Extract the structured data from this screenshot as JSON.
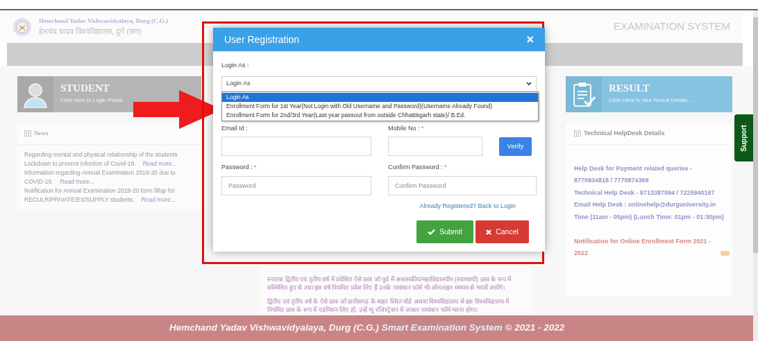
{
  "header": {
    "university_en": "Hemchand Yadav Vishwavidyalaya, Durg (C.G.)",
    "university_hi": "हेमचंद यादव विश्वविद्यालय, दुर्ग (छग)",
    "system_title": "EXAMINATION SYSTEM"
  },
  "cards": [
    {
      "kind": "student",
      "title": "STUDENT",
      "subtitle": "Click here to Login Portal"
    },
    {
      "kind": "result",
      "title": "RESULT",
      "subtitle": "Click Here to See Result Details..."
    }
  ],
  "news": {
    "title": "News",
    "items": [
      {
        "lines": [
          "Regarding mental and physical relationship of the students",
          "Lockdown to prevent infection of Covid-19."
        ],
        "link": "Read more..."
      },
      {
        "lines": [
          "Information regarding Annual Examination 2019-20 due to",
          "COVID-19."
        ],
        "link": "Read more..."
      },
      {
        "lines": [
          "Notification for Annual Examination 2019-20 form fillup for",
          "REGULR/PRIVATE/EX/SUPPLY students."
        ],
        "link": "Read more..."
      }
    ]
  },
  "notice": {
    "paragraphs": [
      "स्नातक द्वितीय एवं तृतीय वर्ष में प्रवेशित ऐसे छात्र जो पूर्व में अशासकीय/महाविद्यालयीन (स्वाध्यायी) छात्र के रूप में सम्मिलित हुए थे तथा इस वर्ष नियमित प्रवेश लिए हैं उनके नामांकन फॉर्म भी ऑनलाइन माध्यम से भरावें जायेंगे।",
      "द्वितीय एवं तृतीय वर्ष के ऐसे छात्र जो छत्तीसगढ़ के बाहर स्थित बोर्ड अथवा विश्वविद्यालय से इस विश्वविद्यालय में नियमित छात्र के रूप में एडमिशन लिए हो, उन्हें न्यू रजिस्ट्रेशन में जाकर नामांकन फॉर्म भरना होगा।"
    ]
  },
  "helpdesk": {
    "title": "Technical HelpDesk Details",
    "lines": [
      "Help Desk for Payment related queries - 8770934818 / 7770874369",
      "Technical Help Desk - 9713387094 / 7225940167",
      "Email Help Desk : onlinehelp@durguniversity.in Time (11am - 05pm) (Lunch Time: 01pm - 01:30pm)"
    ],
    "notification": "Notification for Online Enrollment Form 2021 - 2022"
  },
  "support_tab": "Support",
  "modal": {
    "title": "User Registration",
    "close": "×",
    "login_as": {
      "label": "Login As :",
      "value": "Login As",
      "options": [
        {
          "label": "Login As",
          "selected": true
        },
        {
          "label": "Enrollment Form for 1st Year(Not Login with Old Username and Password)(Username Already Found)",
          "selected": false
        },
        {
          "label": "Enrollment Form for 2nd/3rd Year(Last year passout from outside Chhattisgarh state)/ B.Ed.",
          "selected": false
        }
      ]
    },
    "required_mark": "*",
    "email": {
      "label": "Email Id :",
      "required": false
    },
    "mobile": {
      "label": "Mobile No :",
      "required": true
    },
    "verify": "Verify",
    "password": {
      "label": "Password :",
      "required": true,
      "placeholder": "Password"
    },
    "confirm": {
      "label": "Confirm Password :",
      "required": true,
      "placeholder": "Confirm Password"
    },
    "back_link": "Already Registered? Back to Login",
    "submit": "Submit",
    "cancel": "Cancel"
  },
  "footer": {
    "university": "Hemchand Yadav Vishwavidyalaya, Durg (C.G.)",
    "system": "Smart Examination System",
    "copyright": "© 2021 - 2022"
  }
}
